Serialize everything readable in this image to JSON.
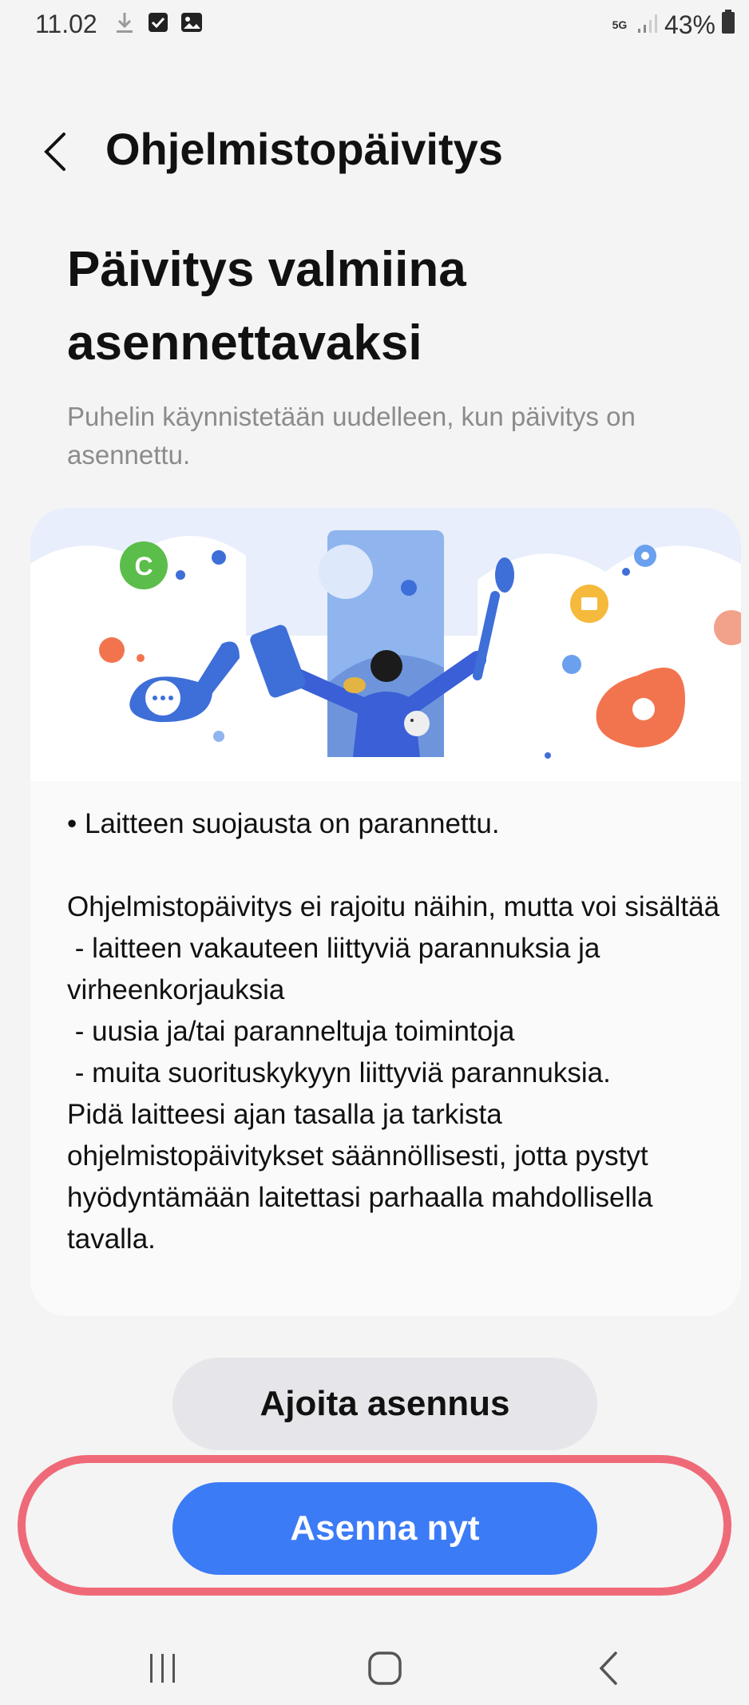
{
  "status_bar": {
    "time": "11.02",
    "network": "5G",
    "battery": "43%",
    "icons": [
      "download-icon",
      "checkbox-icon",
      "gallery-icon",
      "signal-icon",
      "battery-icon"
    ]
  },
  "header": {
    "title": "Ohjelmistopäivitys",
    "back_icon": "back-arrow-icon"
  },
  "hero": {
    "title": "Päivitys valmiina asennettavaksi",
    "subtitle": "Puhelin käynnistetään uudelleen, kun päivitys on asennettu."
  },
  "notes": {
    "bullet": "• Laitteen suojausta on parannettu.",
    "intro": "Ohjelmistopäivitys ei rajoitu näihin, mutta voi sisältää",
    "items": [
      " - laitteen vakauteen liittyviä parannuksia ja virheenkorjauksia",
      " - uusia ja/tai paranneltuja toimintoja",
      " - muita suorituskykyyn liittyviä parannuksia."
    ],
    "closing": "Pidä laitteesi ajan tasalla ja tarkista ohjelmistopäivitykset säännöllisesti, jotta pystyt hyödyntämään laitettasi parhaalla mahdollisella tavalla."
  },
  "buttons": {
    "schedule": "Ajoita asennus",
    "install_now": "Asenna nyt"
  },
  "nav": {
    "icons": [
      "recent-apps-icon",
      "home-icon",
      "back-icon"
    ]
  },
  "colors": {
    "accent": "#3c7bf6",
    "secondary_button": "#e6e6ea",
    "highlight": "#ef6a78",
    "background": "#f4f4f4"
  }
}
